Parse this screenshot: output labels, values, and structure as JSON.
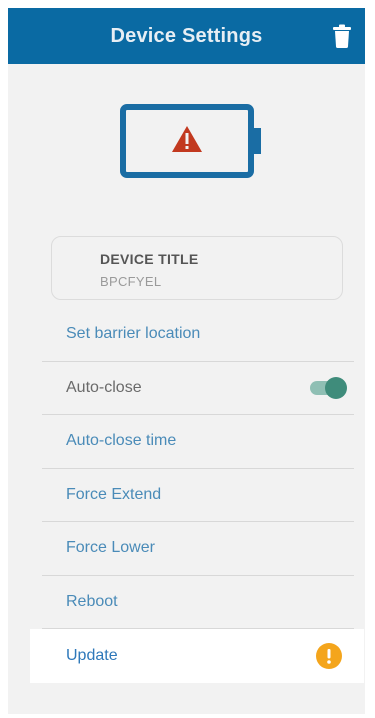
{
  "header": {
    "title": "Device Settings",
    "trash_icon": "trash-icon"
  },
  "battery": {
    "icon": "battery-warning-icon",
    "colors": {
      "outline": "#1a6da4",
      "warning": "#c2391f"
    }
  },
  "device": {
    "title_label": "DEVICE TITLE",
    "id": "BPCFYEL"
  },
  "menu": {
    "items": [
      {
        "label": "Set barrier location"
      },
      {
        "label": "Auto-close",
        "toggle_on": true
      },
      {
        "label": "Auto-close time"
      },
      {
        "label": "Force Extend"
      },
      {
        "label": "Force Lower"
      },
      {
        "label": "Reboot"
      },
      {
        "label": "Update",
        "badge_icon": "alert-icon"
      }
    ]
  },
  "colors": {
    "app_bar": "#0a6aa3",
    "link": "#4a8bb8",
    "toggle_knob": "#3f8c7b",
    "alert": "#f4a51c"
  }
}
